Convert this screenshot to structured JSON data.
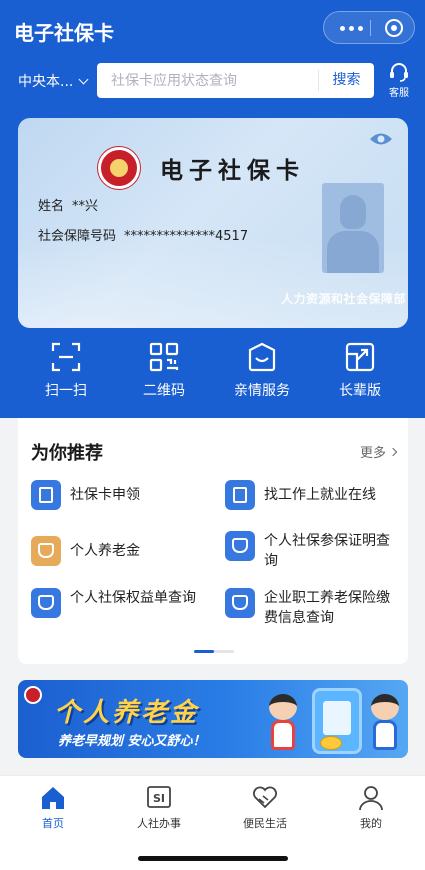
{
  "app": {
    "title": "电子社保卡"
  },
  "header": {
    "region": "中央本...",
    "search_placeholder": "社保卡应用状态查询",
    "search_button": "搜索",
    "service_label": "客服"
  },
  "card": {
    "title": "电子社保卡",
    "name_label": "姓名",
    "name_value": "**兴",
    "id_label": "社会保障号码",
    "id_value": "**************4517",
    "issuer": "人力资源和社会保障部"
  },
  "quick_actions": [
    {
      "label": "扫一扫",
      "icon": "scan-icon"
    },
    {
      "label": "二维码",
      "icon": "qrcode-icon"
    },
    {
      "label": "亲情服务",
      "icon": "family-service-icon"
    },
    {
      "label": "长辈版",
      "icon": "elder-mode-icon"
    }
  ],
  "recommend": {
    "title": "为你推荐",
    "more": "更多",
    "items": [
      {
        "label": "社保卡申领",
        "icon": "id-card-icon"
      },
      {
        "label": "找工作上就业在线",
        "icon": "document-icon"
      },
      {
        "label": "个人养老金",
        "icon": "piggy-bank-icon"
      },
      {
        "label": "个人社保参保证明查询",
        "icon": "shield-search-icon"
      },
      {
        "label": "个人社保权益单查询",
        "icon": "shield-search-icon"
      },
      {
        "label": "企业职工养老保险缴费信息查询",
        "icon": "shield-search-icon"
      }
    ]
  },
  "banner": {
    "title": "个人养老金",
    "subtitle": "养老早规划 安心又舒心！"
  },
  "tabs": [
    {
      "label": "首页",
      "icon": "home-icon",
      "active": true
    },
    {
      "label": "人社办事",
      "icon": "si-icon",
      "active": false
    },
    {
      "label": "便民生活",
      "icon": "heart-hands-icon",
      "active": false
    },
    {
      "label": "我的",
      "icon": "person-icon",
      "active": false
    }
  ],
  "colors": {
    "primary": "#1a5fd1",
    "accent_orange": "#e7a95a",
    "banner_gold": "#ffd24a"
  }
}
